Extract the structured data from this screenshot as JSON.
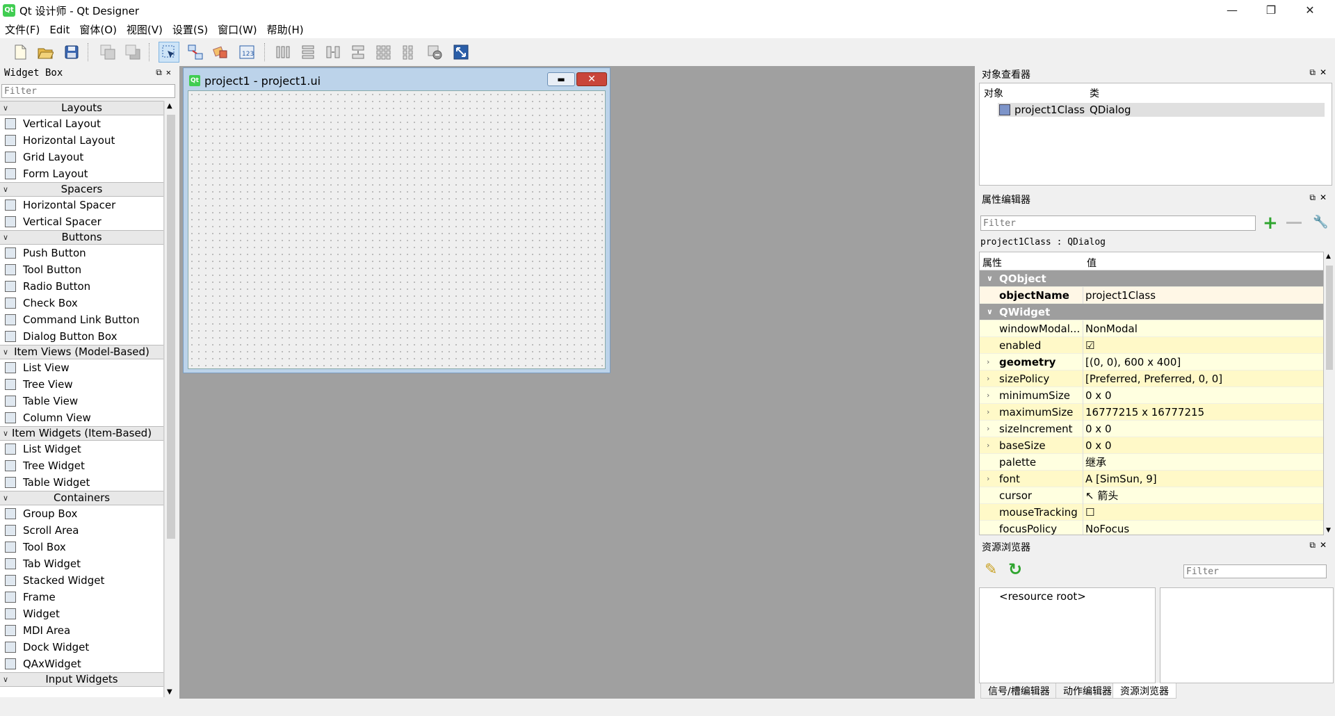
{
  "window": {
    "title": "Qt 设计师 - Qt Designer",
    "app_icon_text": "Qt",
    "minimize": "—",
    "restore": "❐",
    "close": "✕"
  },
  "menubar": [
    "文件(F)",
    "Edit",
    "窗体(O)",
    "视图(V)",
    "设置(S)",
    "窗口(W)",
    "帮助(H)"
  ],
  "toolbar": {
    "icons": [
      "new-file-icon",
      "open-file-icon",
      "save-icon",
      "send-backward-icon",
      "bring-forward-icon",
      "edit-widgets-icon",
      "edit-signals-slots-icon",
      "edit-buddies-icon",
      "edit-tab-order-icon",
      "layout-horizontal-icon",
      "layout-vertical-icon",
      "layout-horizontal-splitter-icon",
      "layout-vertical-splitter-icon",
      "layout-grid-icon",
      "layout-form-icon",
      "break-layout-icon",
      "adjust-size-icon"
    ]
  },
  "widget_box": {
    "title": "Widget Box",
    "filter_placeholder": "Filter",
    "categories": [
      {
        "name": "Layouts",
        "items": [
          "Vertical Layout",
          "Horizontal Layout",
          "Grid Layout",
          "Form Layout"
        ]
      },
      {
        "name": "Spacers",
        "items": [
          "Horizontal Spacer",
          "Vertical Spacer"
        ]
      },
      {
        "name": "Buttons",
        "items": [
          "Push Button",
          "Tool Button",
          "Radio Button",
          "Check Box",
          "Command Link Button",
          "Dialog Button Box"
        ]
      },
      {
        "name": "Item Views (Model-Based)",
        "items": [
          "List View",
          "Tree View",
          "Table View",
          "Column View"
        ]
      },
      {
        "name": "Item Widgets (Item-Based)",
        "items": [
          "List Widget",
          "Tree Widget",
          "Table Widget"
        ]
      },
      {
        "name": "Containers",
        "items": [
          "Group Box",
          "Scroll Area",
          "Tool Box",
          "Tab Widget",
          "Stacked Widget",
          "Frame",
          "Widget",
          "MDI Area",
          "Dock Widget",
          "QAxWidget"
        ]
      },
      {
        "name": "Input Widgets",
        "items": []
      }
    ]
  },
  "form_window": {
    "title": "project1 - project1.ui",
    "min_btn": "▬",
    "close_btn": "✕"
  },
  "object_inspector": {
    "title": "对象查看器",
    "col_object": "对象",
    "col_class": "类",
    "rows": [
      {
        "object": "project1Class",
        "class": "QDialog"
      }
    ]
  },
  "property_editor": {
    "title": "属性编辑器",
    "filter_placeholder": "Filter",
    "class_line": "project1Class : QDialog",
    "col_property": "属性",
    "col_value": "值",
    "rows": [
      {
        "type": "group",
        "name": "QObject"
      },
      {
        "type": "prop",
        "name": "objectName",
        "value": "project1Class",
        "bold": true,
        "expand": false
      },
      {
        "type": "group",
        "name": "QWidget"
      },
      {
        "type": "prop",
        "name": "windowModal...",
        "value": "NonModal",
        "bold": false,
        "expand": false
      },
      {
        "type": "prop",
        "name": "enabled",
        "value": "☑",
        "bold": false,
        "expand": false
      },
      {
        "type": "prop",
        "name": "geometry",
        "value": "[(0, 0), 600 x 400]",
        "bold": true,
        "expand": true
      },
      {
        "type": "prop",
        "name": "sizePolicy",
        "value": "[Preferred, Preferred, 0, 0]",
        "bold": false,
        "expand": true
      },
      {
        "type": "prop",
        "name": "minimumSize",
        "value": "0 x 0",
        "bold": false,
        "expand": true
      },
      {
        "type": "prop",
        "name": "maximumSize",
        "value": "16777215 x 16777215",
        "bold": false,
        "expand": true
      },
      {
        "type": "prop",
        "name": "sizeIncrement",
        "value": "0 x 0",
        "bold": false,
        "expand": true
      },
      {
        "type": "prop",
        "name": "baseSize",
        "value": "0 x 0",
        "bold": false,
        "expand": true
      },
      {
        "type": "prop",
        "name": "palette",
        "value": "继承",
        "bold": false,
        "expand": false
      },
      {
        "type": "prop",
        "name": "font",
        "value": "A  [SimSun, 9]",
        "bold": false,
        "expand": true
      },
      {
        "type": "prop",
        "name": "cursor",
        "value": "↖  箭头",
        "bold": false,
        "expand": false
      },
      {
        "type": "prop",
        "name": "mouseTracking",
        "value": "☐",
        "bold": false,
        "expand": false
      },
      {
        "type": "prop",
        "name": "focusPolicy",
        "value": "NoFocus",
        "bold": false,
        "expand": false
      }
    ]
  },
  "resource_browser": {
    "title": "资源浏览器",
    "filter_placeholder": "Filter",
    "root": "<resource root>",
    "tabs": [
      "信号/槽编辑器",
      "动作编辑器",
      "资源浏览器"
    ],
    "selected_tab": 2
  },
  "colors": {
    "mdi_background": "#a0a0a0",
    "group_row": "#9e9e9e",
    "property_highlight": "#fff9c8",
    "qt_green": "#41cd52"
  }
}
